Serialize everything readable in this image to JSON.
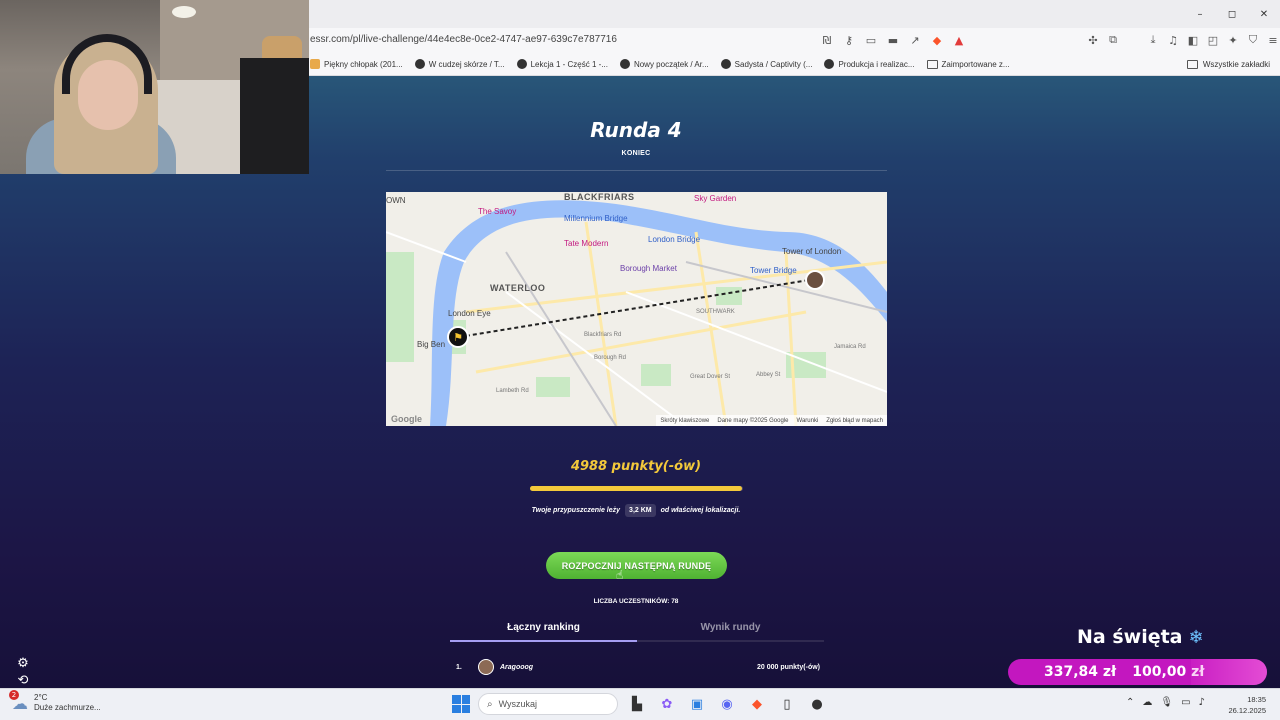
{
  "browser": {
    "window_controls": [
      "–",
      "◻",
      "✕"
    ],
    "url": "essr.com/pl/live-challenge/44e4ec8e-0ce2-4747-ae97-639c7e787716",
    "bookmarks": [
      "Piękny chłopak (201...",
      "W cudzej skórze / T...",
      "Lekcja 1 - Część 1 -...",
      "Nowy początek / Ar...",
      "Sadysta / Captivity (...",
      "Produkcja i realizac...",
      "Zaimportowane z..."
    ],
    "bookmarks_right": "Wszystkie zakładki"
  },
  "round": {
    "title": "Runda 4",
    "status": "KONIEC"
  },
  "map": {
    "labels": {
      "blackfriars": "BLACKFRIARS",
      "savoy": "The Savoy",
      "millennium_bridge": "Millennium Bridge",
      "sky_garden": "Sky Garden",
      "tate_modern": "Tate Modern",
      "london_bridge": "London Bridge",
      "tower_of_london": "Tower of London",
      "tower_bridge": "Tower Bridge",
      "borough_market": "Borough Market",
      "waterloo": "WATERLOO",
      "london_eye": "London Eye",
      "big_ben": "Big Ben",
      "southwark": "SOUTHWARK",
      "borough_rd": "Borough Rd",
      "lambeth_rd": "Lambeth Rd",
      "blackfriars_rd": "Blackfriars Rd",
      "great_dover_st": "Great Dover St",
      "abbey_st": "Abbey St",
      "jamaica_rd": "Jamaica Rd",
      "own": "OWN"
    },
    "footer": [
      "Skróty klawiszowe",
      "Dane mapy ©2025 Google",
      "Warunki",
      "Zgłoś błąd w mapach"
    ],
    "google": "Google"
  },
  "result": {
    "points": "4988 punkty(-ów)",
    "score_fraction": 0.9976,
    "guess_prefix": "Twoje przypuszczenie leży",
    "distance": "3,2 KM",
    "guess_suffix": "od właściwej lokalizacji."
  },
  "actions": {
    "next_round": "ROZPOCZNIJ NASTĘPNĄ RUNDĘ"
  },
  "participants": "LICZBA UCZESTNIKÓW: 78",
  "tabs": [
    "Łączny ranking",
    "Wynik rundy"
  ],
  "ranking": [
    {
      "rank": "1.",
      "name": "Aragooog",
      "points": "20 000 punkty(-ów)"
    }
  ],
  "donation": {
    "label": "Na święta",
    "current": "337,84 zł",
    "goal": "100,00 zł"
  },
  "taskbar": {
    "weather_badge": "2",
    "temperature": "2°C",
    "weather": "Duże zachmurze...",
    "search_placeholder": "Wyszukaj",
    "time": "18:35",
    "date": "26.12.2025"
  },
  "colors": {
    "accent_gold": "#f3c93b",
    "button_green": "#5cc23b",
    "tab_active": "#a59ef3",
    "donation_pink": "#c317bf"
  }
}
